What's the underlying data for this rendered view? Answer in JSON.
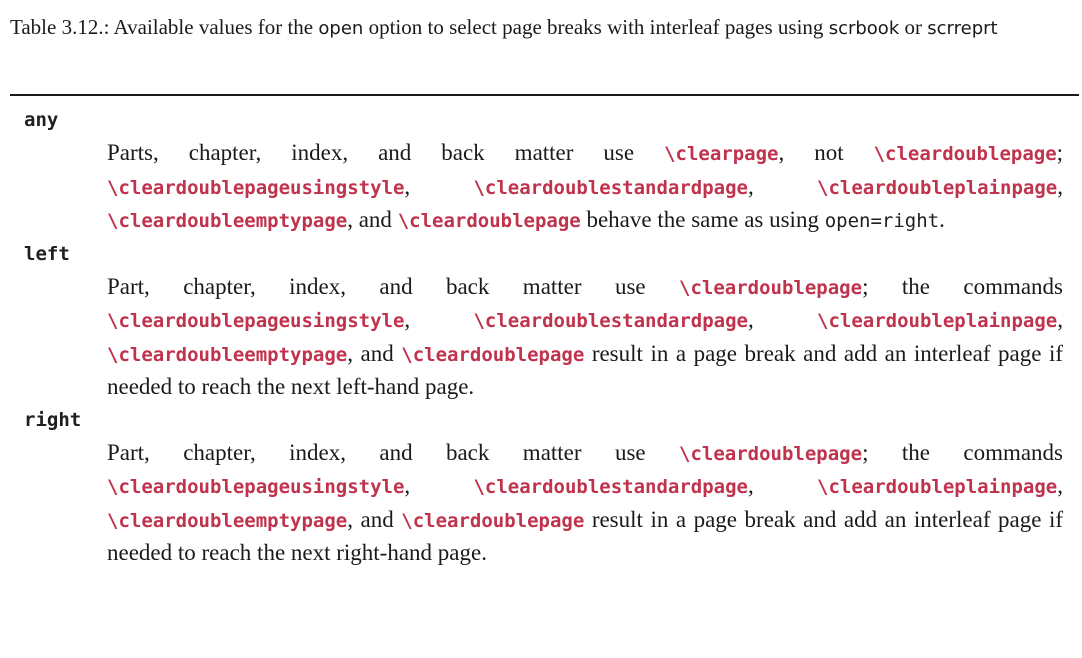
{
  "caption": {
    "number": "Table 3.12.:",
    "text_before": "Available values for the",
    "option": "open",
    "text_middle": "option to select page breaks with interleaf pages using",
    "class1": "scrbook",
    "conj": "or",
    "class2": "scrreprt"
  },
  "entries": [
    {
      "term": "any",
      "p1": "Parts, chapter, index, and back matter use",
      "c1": "\\clearpage",
      "p2": ", not",
      "c2": "\\cleardoublepage",
      "p3": ";",
      "c3": "\\cleardoublepageusingstyle",
      "p4": ",",
      "c4": "\\cleardoublestandardpage",
      "p5": ",",
      "c5": "\\cleardoubleplainpage",
      "p6": ",",
      "c6": "\\cleardoubleemptypage",
      "p7": ", and",
      "c7": "\\cleardoublepage",
      "p8": "behave the same as using",
      "m1": "open=right",
      "p9": "."
    },
    {
      "term": "left",
      "p1": "Part, chapter, index, and back matter use",
      "c1": "\\cleardoublepage",
      "p2": "; the commands",
      "c2": "\\cleardoublepageusingstyle",
      "p3": ",",
      "c3": "\\cleardoublestandardpage",
      "p4": ",",
      "c4": "\\cleardoubleplainpage",
      "p5": ",",
      "c5": "\\cleardoubleemptypage",
      "p6": ", and",
      "c6": "\\cleardoublepage",
      "p7": "result in a page break and add an interleaf page if needed to reach the next left-hand page."
    },
    {
      "term": "right",
      "p1": "Part, chapter, index, and back matter use",
      "c1": "\\cleardoublepage",
      "p2": "; the commands",
      "c2": "\\cleardoublepageusingstyle",
      "p3": ",",
      "c3": "\\cleardoublestandardpage",
      "p4": ",",
      "c4": "\\cleardoubleplainpage",
      "p5": ",",
      "c5": "\\cleardoubleemptypage",
      "p6": ", and",
      "c6": "\\cleardoublepage",
      "p7": "result in a page break and add an interleaf page if needed to reach the next right-hand page."
    }
  ],
  "colors": {
    "command": "#c0334d",
    "text": "#1a1a1a"
  }
}
